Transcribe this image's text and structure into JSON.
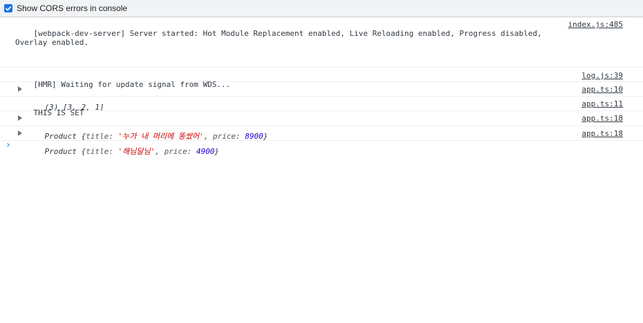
{
  "toolbar": {
    "cors_label": "Show CORS errors in console",
    "cors_checked": true,
    "accent": "#1a73e8"
  },
  "messages": [
    {
      "text": "[webpack-dev-server] Server started: Hot Module Replacement enabled, Live Reloading enabled, Progress disabled, Overlay enabled.",
      "source": "index.js:485"
    },
    {
      "text": "[HMR] Waiting for update signal from WDS...",
      "source": "log.js:39"
    },
    {
      "text": "(3) [3, 2, 1]",
      "source": "app.ts:10"
    },
    {
      "text": "THIS IS SET",
      "source": "app.ts:11"
    },
    {
      "class_name": "Product",
      "title_key": "title:",
      "title_value": "'누가 내 머리에 똥쌌어'",
      "price_key": "price:",
      "price_value": "8900",
      "source": "app.ts:18"
    },
    {
      "class_name": "Product",
      "title_key": "title:",
      "title_value": "'해님달님'",
      "price_key": "price:",
      "price_value": "4900",
      "source": "app.ts:18"
    }
  ],
  "prompt_icon": "chevron-right-icon"
}
